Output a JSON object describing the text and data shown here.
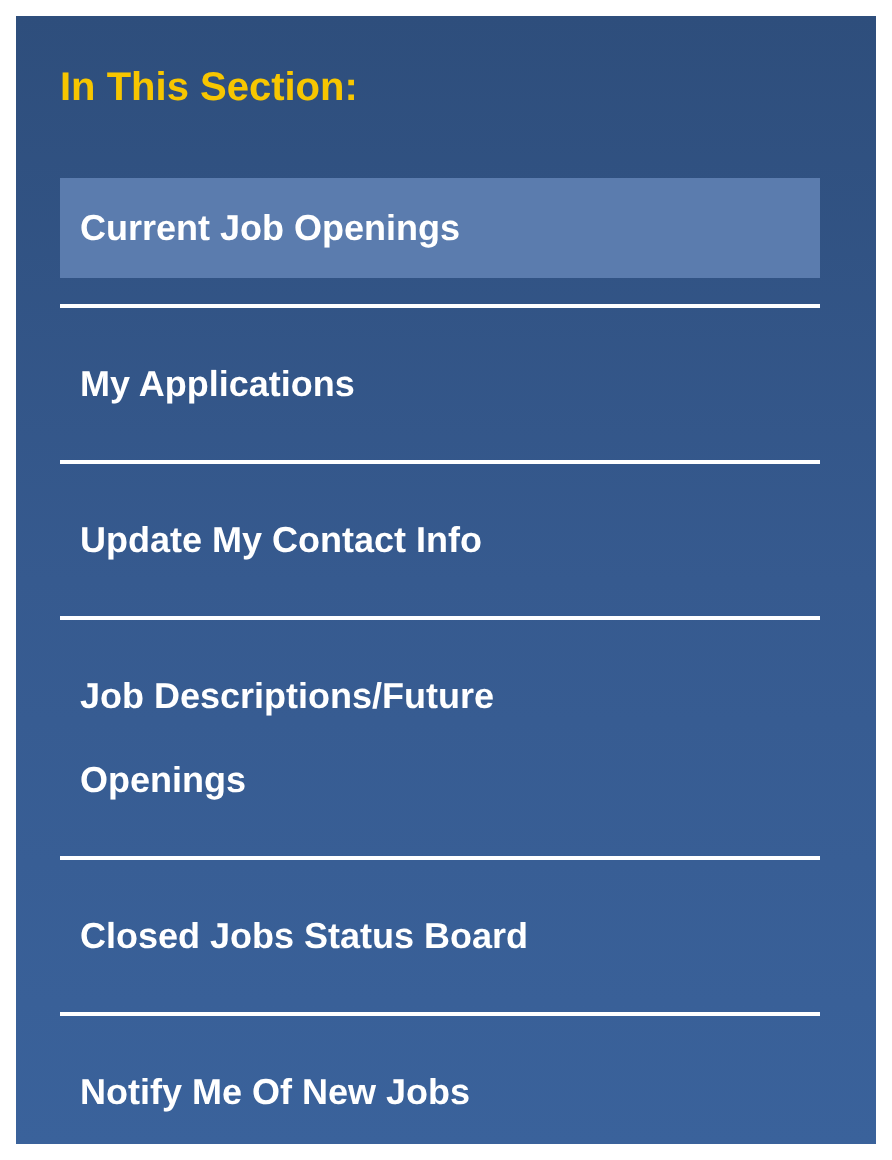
{
  "section": {
    "title": "In This Section:"
  },
  "items": [
    {
      "label": "Current Job Openings",
      "selected": true
    },
    {
      "label": "My Applications",
      "selected": false
    },
    {
      "label": "Update My Contact Info",
      "selected": false
    },
    {
      "label": "Job Descriptions/Future Openings",
      "selected": false
    },
    {
      "label": "Closed Jobs Status Board",
      "selected": false
    },
    {
      "label": "Notify Me Of New Jobs",
      "selected": false
    }
  ]
}
